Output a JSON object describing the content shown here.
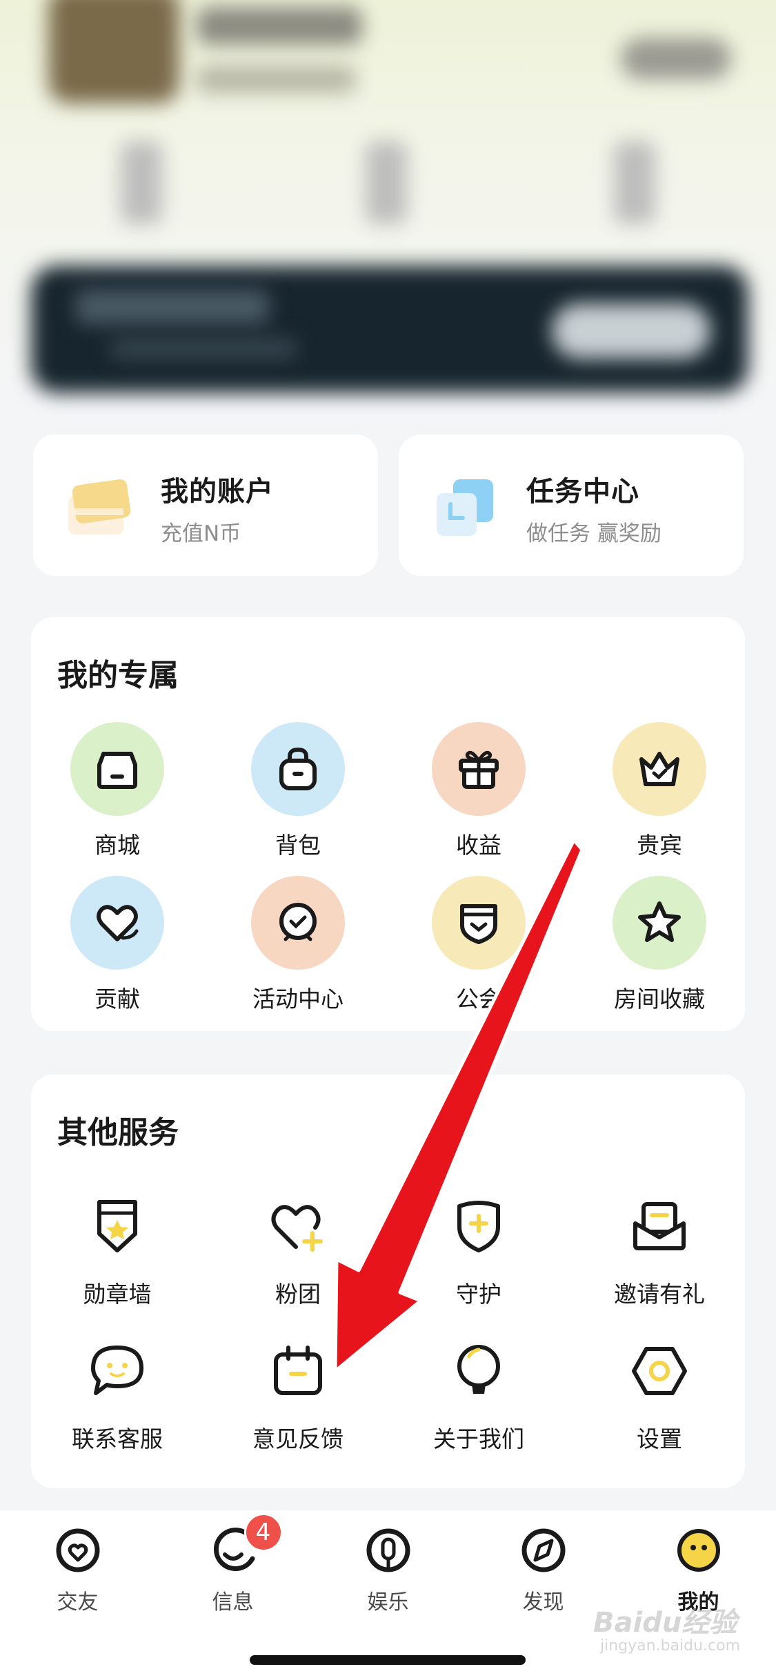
{
  "quick_cards": [
    {
      "title": "我的账户",
      "subtitle": "充值N币",
      "icon": "card-icon"
    },
    {
      "title": "任务中心",
      "subtitle": "做任务 赢奖励",
      "icon": "task-icon"
    }
  ],
  "exclusive": {
    "title": "我的专属",
    "items": [
      {
        "label": "商城",
        "icon": "shop-icon",
        "color": "#d9f0c8"
      },
      {
        "label": "背包",
        "icon": "backpack-icon",
        "color": "#cde8f7"
      },
      {
        "label": "收益",
        "icon": "gift-icon",
        "color": "#f7d6c2"
      },
      {
        "label": "贵宾",
        "icon": "crown-icon",
        "color": "#f7e9b8"
      },
      {
        "label": "贡献",
        "icon": "heart-icon",
        "color": "#cde8f7"
      },
      {
        "label": "活动中心",
        "icon": "activity-icon",
        "color": "#f7d6c2"
      },
      {
        "label": "公会",
        "icon": "guild-icon",
        "color": "#f7e9b8"
      },
      {
        "label": "房间收藏",
        "icon": "star-icon",
        "color": "#d9f0c8"
      }
    ]
  },
  "services": {
    "title": "其他服务",
    "items": [
      {
        "label": "勋章墙",
        "icon": "medal-icon"
      },
      {
        "label": "粉团",
        "icon": "fan-heart-icon"
      },
      {
        "label": "守护",
        "icon": "shield-icon"
      },
      {
        "label": "邀请有礼",
        "icon": "envelope-icon"
      },
      {
        "label": "联系客服",
        "icon": "chat-icon"
      },
      {
        "label": "意见反馈",
        "icon": "feedback-icon"
      },
      {
        "label": "关于我们",
        "icon": "bulb-icon"
      },
      {
        "label": "设置",
        "icon": "hexagon-settings-icon"
      }
    ]
  },
  "bottom_nav": {
    "items": [
      {
        "label": "交友",
        "icon": "friends-icon"
      },
      {
        "label": "信息",
        "icon": "message-icon",
        "badge": "4"
      },
      {
        "label": "娱乐",
        "icon": "entertainment-icon"
      },
      {
        "label": "发现",
        "icon": "discover-icon"
      },
      {
        "label": "我的",
        "icon": "me-icon",
        "active": true
      }
    ]
  },
  "watermark": {
    "text": "Baidu经验",
    "sub": "jingyan.baidu.com"
  },
  "colors": {
    "accent_yellow": "#f5d547",
    "annotation_red": "#e8141b"
  }
}
